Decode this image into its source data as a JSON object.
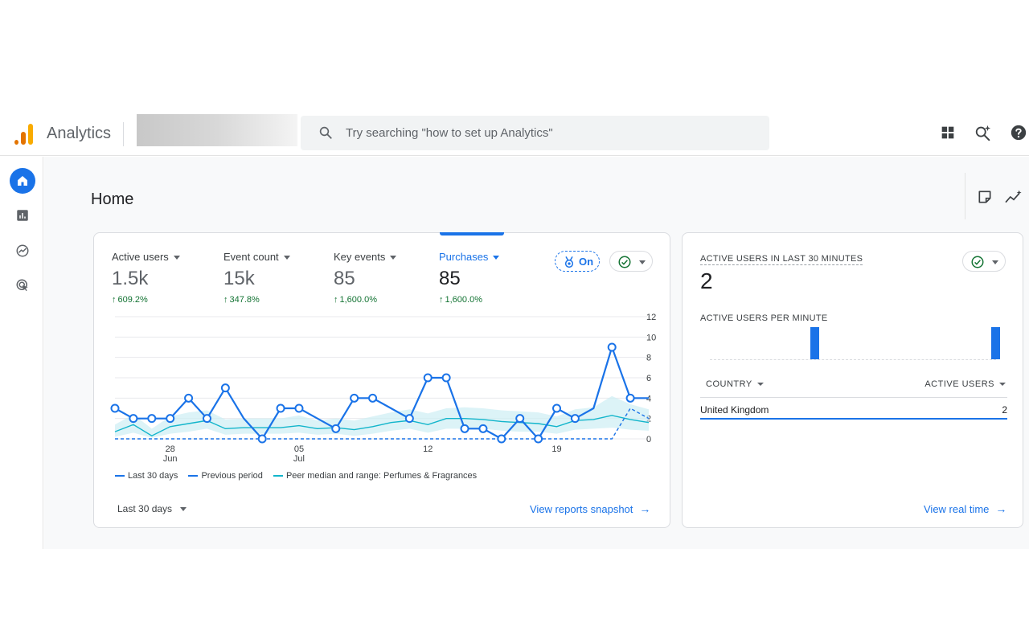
{
  "header": {
    "app_title": "Analytics",
    "search_placeholder": "Try searching \"how to set up Analytics\""
  },
  "icons": {
    "logo": "analytics-logo",
    "search": "search-icon",
    "apps": "apps-grid-icon",
    "insights": "search-sparkle-icon",
    "help": "help-icon",
    "nav": [
      "home-icon",
      "reports-icon",
      "explore-icon",
      "advertising-icon"
    ],
    "tools": [
      "notes-icon",
      "insights-icon"
    ]
  },
  "colors": {
    "accent": "#1a73e8",
    "positive": "#137333",
    "peer_line": "#12b5cb",
    "peer_band": "#cdeef3"
  },
  "page": {
    "title": "Home"
  },
  "metrics": [
    {
      "label": "Active users",
      "value": "1.5k",
      "change": "609.2%"
    },
    {
      "label": "Event count",
      "value": "15k",
      "change": "347.8%"
    },
    {
      "label": "Key events",
      "value": "85",
      "change": "1,600.0%"
    },
    {
      "label": "Purchases",
      "value": "85",
      "change": "1,600.0%",
      "selected": true
    }
  ],
  "badges": {
    "on_label": "On"
  },
  "chart_data": {
    "type": "line",
    "x_tick_labels": [
      {
        "day": "28",
        "month": "Jun"
      },
      {
        "day": "05",
        "month": "Jul"
      },
      {
        "day": "12",
        "month": ""
      },
      {
        "day": "19",
        "month": ""
      }
    ],
    "y_ticks": [
      "12",
      "10",
      "8",
      "6",
      "4",
      "2",
      "0"
    ],
    "ylim": [
      0,
      12
    ],
    "grid": true,
    "series": [
      {
        "name": "Last 30 days",
        "style": "solid",
        "values": [
          3,
          2,
          2,
          2,
          4,
          2,
          5,
          2,
          0,
          3,
          3,
          2,
          1,
          4,
          4,
          3,
          2,
          6,
          6,
          1,
          1,
          0,
          2,
          0,
          3,
          2,
          3,
          9,
          4,
          4
        ]
      },
      {
        "name": "Previous period",
        "style": "dashed",
        "values": [
          0,
          0,
          0,
          0,
          0,
          0,
          0,
          0,
          0,
          0,
          0,
          0,
          0,
          0,
          0,
          0,
          0,
          0,
          0,
          0,
          0,
          0,
          0,
          0,
          0,
          0,
          0,
          0,
          3,
          2
        ]
      },
      {
        "name": "Peer median and range: Perfumes & Fragrances",
        "style": "band",
        "values": [
          0.7,
          1.4,
          0.3,
          1.2,
          1.5,
          1.8,
          1.0,
          1.1,
          1.1,
          1.1,
          1.3,
          1.0,
          1.1,
          0.9,
          1.2,
          1.6,
          1.8,
          1.4,
          2.0,
          2.0,
          1.9,
          1.7,
          1.6,
          1.5,
          1.2,
          1.8,
          1.9,
          2.3,
          1.9,
          1.6
        ],
        "low": [
          0.2,
          0.6,
          0.1,
          0.5,
          0.7,
          1.0,
          0.4,
          0.5,
          0.5,
          0.5,
          0.6,
          0.4,
          0.5,
          0.3,
          0.5,
          0.8,
          1.0,
          0.6,
          1.0,
          1.0,
          1.0,
          0.8,
          0.7,
          0.7,
          0.5,
          0.9,
          1.0,
          1.1,
          0.9,
          0.8
        ],
        "high": [
          1.4,
          2.4,
          1.0,
          2.2,
          2.6,
          2.8,
          1.9,
          2.0,
          2.0,
          2.0,
          2.3,
          1.8,
          2.0,
          1.8,
          2.2,
          2.6,
          2.9,
          2.5,
          3.0,
          3.1,
          3.0,
          2.8,
          2.7,
          2.6,
          2.2,
          2.9,
          3.1,
          4.2,
          3.4,
          2.9
        ]
      }
    ]
  },
  "legend": {
    "last30": "Last 30 days",
    "previous": "Previous period",
    "peer": "Peer median and range: Perfumes & Fragrances"
  },
  "footer": {
    "date_range": "Last 30 days",
    "snapshot_link": "View reports snapshot"
  },
  "realtime": {
    "title": "ACTIVE USERS IN LAST 30 MINUTES",
    "value": "2",
    "per_minute_label": "ACTIVE USERS PER MINUTE",
    "per_minute_values": [
      0,
      0,
      0,
      0,
      0,
      0,
      0,
      0,
      0,
      0,
      1,
      0,
      0,
      0,
      0,
      0,
      0,
      0,
      0,
      0,
      0,
      0,
      0,
      0,
      0,
      0,
      0,
      0,
      0,
      1
    ],
    "col_country": "COUNTRY",
    "col_users": "ACTIVE USERS",
    "rows": [
      {
        "country": "United Kingdom",
        "users": "2"
      }
    ],
    "link": "View real time"
  }
}
